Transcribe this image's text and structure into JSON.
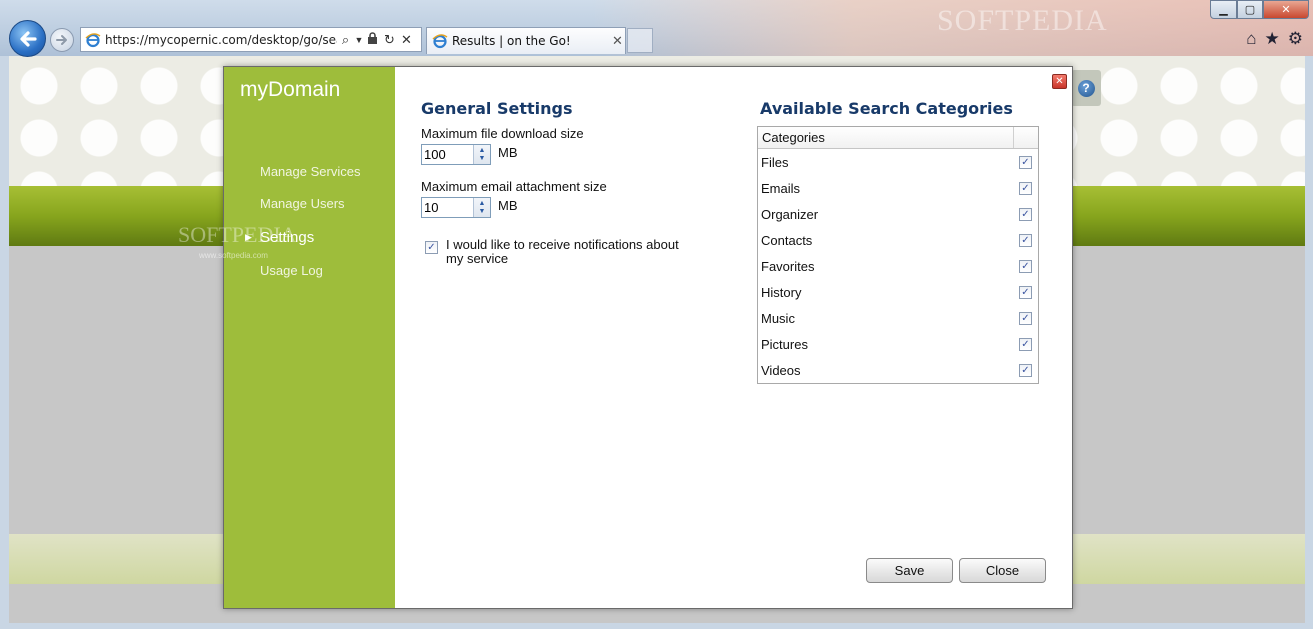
{
  "browser": {
    "address": "https://mycopernic.com/desktop/go/search",
    "tab_title": "Results | on the Go!",
    "watermark": "SOFTPEDIA"
  },
  "dialog": {
    "title": "myDomain",
    "nav": [
      {
        "label": "Manage Services"
      },
      {
        "label": "Manage Users"
      },
      {
        "label": "Settings",
        "active": true
      },
      {
        "label": "Usage Log"
      }
    ],
    "sidebar_watermark": "SOFTPEDIA",
    "sidebar_watermark_url": "www.softpedia.com",
    "general": {
      "title": "General Settings",
      "download_label": "Maximum file download size",
      "download_value": "100",
      "download_unit": "MB",
      "attachment_label": "Maximum email attachment size",
      "attachment_value": "10",
      "attachment_unit": "MB",
      "notify_label": "I would like to receive notifications about my service",
      "notify_checked": true
    },
    "categories": {
      "title": "Available Search Categories",
      "header": "Categories",
      "items": [
        {
          "label": "Files",
          "checked": true
        },
        {
          "label": "Emails",
          "checked": true
        },
        {
          "label": "Organizer",
          "checked": true
        },
        {
          "label": "Contacts",
          "checked": true
        },
        {
          "label": "Favorites",
          "checked": true
        },
        {
          "label": "History",
          "checked": true
        },
        {
          "label": "Music",
          "checked": true
        },
        {
          "label": "Pictures",
          "checked": true
        },
        {
          "label": "Videos",
          "checked": true
        }
      ]
    },
    "save_label": "Save",
    "close_label": "Close"
  },
  "colors": {
    "sidebar": "#9ebd3b",
    "section_title": "#183a69",
    "band": "#87a51d"
  }
}
